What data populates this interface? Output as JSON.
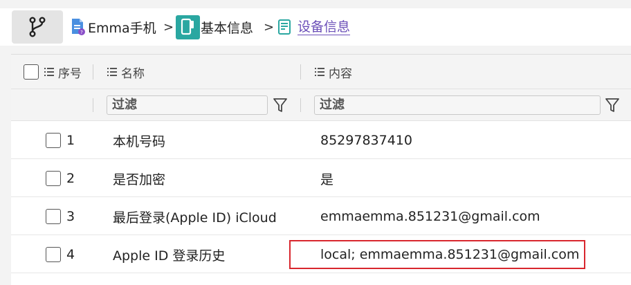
{
  "breadcrumb": {
    "items": [
      {
        "label": "Emma手机",
        "icon": "phone-report-icon"
      },
      {
        "label": "基本信息",
        "icon": "phone-info-icon"
      },
      {
        "label": "设备信息",
        "icon": "document-icon",
        "active": true
      }
    ],
    "separator": ">"
  },
  "table": {
    "columns": [
      {
        "label": "序号",
        "icon": "list-icon"
      },
      {
        "label": "名称",
        "icon": "list-icon"
      },
      {
        "label": "内容",
        "icon": "list-icon"
      }
    ],
    "filter": {
      "placeholder_name": "过滤",
      "placeholder_content": "过滤"
    },
    "rows": [
      {
        "index": "1",
        "name": "本机号码",
        "content": "85297837410"
      },
      {
        "index": "2",
        "name": "是否加密",
        "content": "是"
      },
      {
        "index": "3",
        "name": "最后登录(Apple ID) iCloud",
        "content": "emmaemma.851231@gmail.com"
      },
      {
        "index": "4",
        "name": "Apple ID 登录历史",
        "content": "local; emmaemma.851231@gmail.com",
        "highlighted": true
      }
    ]
  },
  "colors": {
    "accent": "#6b4fb8",
    "teal": "#2aa7a1",
    "highlight": "#d8262d"
  }
}
